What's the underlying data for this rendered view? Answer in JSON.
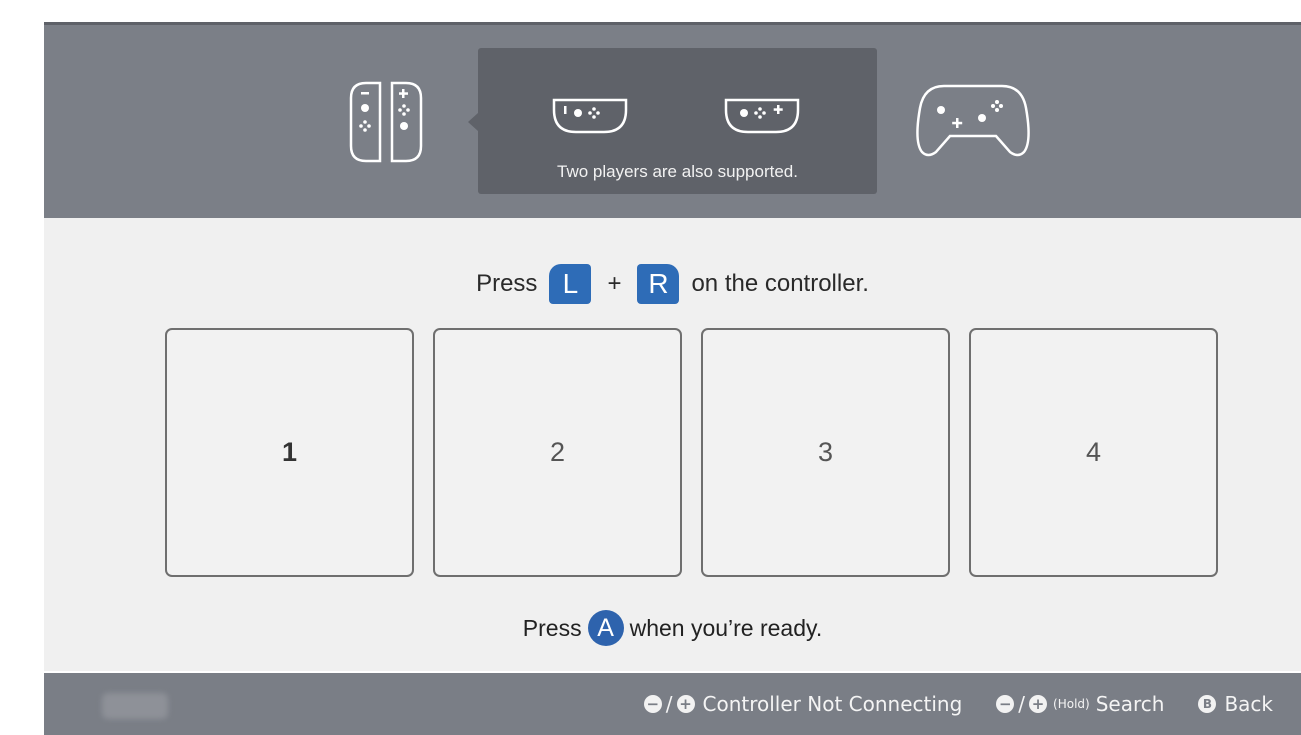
{
  "header": {
    "icons": [
      "joy-con-pair-icon",
      "sideways-joy-con-left-icon",
      "sideways-joy-con-right-icon",
      "pro-controller-icon"
    ],
    "tooltip_text": "Two players are also supported."
  },
  "instruction": {
    "press_label": "Press",
    "key_l": "L",
    "plus": "+",
    "key_r": "R",
    "suffix": "on the controller."
  },
  "slots": [
    {
      "label": "1",
      "selected": true
    },
    {
      "label": "2",
      "selected": false
    },
    {
      "label": "3",
      "selected": false
    },
    {
      "label": "4",
      "selected": false
    }
  ],
  "ready": {
    "press_label": "Press",
    "button": "A",
    "suffix": "when you’re ready."
  },
  "footer": {
    "minus_symbol": "−",
    "plus_symbol": "+",
    "slash": "/",
    "not_connecting_label": "Controller Not Connecting",
    "hold_label": "(Hold)",
    "search_label": "Search",
    "b_button": "B",
    "back_label": "Back"
  },
  "colors": {
    "header_bg": "#7b7f87",
    "tooltip_bg": "#5f6269",
    "button_blue": "#2e6cb7",
    "panel_bg": "#f0f0f0"
  }
}
